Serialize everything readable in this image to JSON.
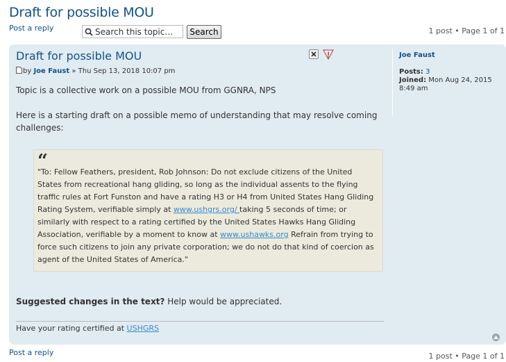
{
  "topic": {
    "title": "Draft for possible MOU",
    "post_reply": "Post a reply",
    "pagination": "1 post • Page 1 of 1"
  },
  "search": {
    "placeholder": "Search this topic…",
    "button": "Search"
  },
  "post": {
    "title": "Draft for possible MOU",
    "by": "by",
    "author": "Joe Faust",
    "date": " » Thu Sep 13, 2018 10:07 pm",
    "paragraph1": "Topic is a collective work on a possible MOU from GGNRA, NPS",
    "paragraph2": "Here is a starting draft on a possible memo of understanding that may resolve coming challenges:",
    "quote": {
      "mark": "“",
      "part1": "\"To: Fellow Feathers, president, Rob Johnson: Do not exclude citizens of the United States from recreational hang gliding, so long as the individual assents to the flying traffic rules at Fort Funston and have a rating H3 or H4 from United States Hang Gliding Rating System, verifiable simply at ",
      "link1": "www.ushgrs.org/ ",
      "part2": " taking 5 seconds of time; or similarly with respect to a rating certified by the United States Hawks Hang Gliding Association, verifiable by a moment to know at ",
      "link2": "www.ushawks.org",
      "part3": " Refrain from trying to force such citizens to join any private corporation; we do not do that kind of coercion as agent of the United States of America.\""
    },
    "closing_bold": "Suggested changes in the text?",
    "closing_rest": " Help would be appreciated.",
    "signature_text": "Have your rating certified at ",
    "signature_link": "USHGRS",
    "colors": {
      "post_bg": "#e1ebf2",
      "quote_bg": "#ebeadd",
      "link": "#105289"
    }
  },
  "profile": {
    "name": "Joe Faust",
    "posts_label": "Posts:",
    "posts_value": " 3",
    "joined_label": "Joined:",
    "joined_value": " Mon Aug 24, 2015 8:49 am"
  },
  "icons": [
    "search-icon",
    "post-icon",
    "delete-icon",
    "warning-icon",
    "back-to-top-icon"
  ]
}
